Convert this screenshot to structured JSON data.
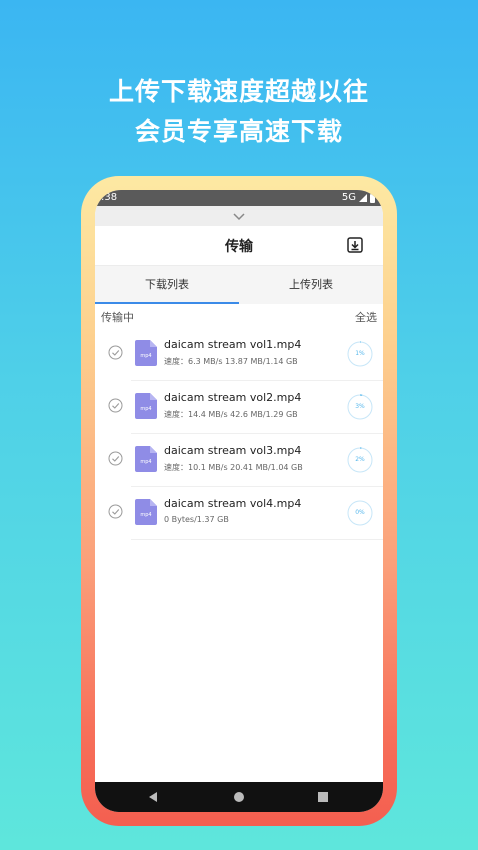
{
  "promo": {
    "line1": "上传下载速度超越以往",
    "line2": "会员专享高速下载"
  },
  "statusbar": {
    "time": ":38",
    "network": "5G"
  },
  "appbar": {
    "title": "传输"
  },
  "tabs": [
    {
      "label": "下载列表",
      "active": true
    },
    {
      "label": "上传列表",
      "active": false
    }
  ],
  "section": {
    "label": "传输中",
    "select_all": "全选"
  },
  "file_icon_text": "mp4",
  "downloads": [
    {
      "name": "daicam stream vol1.mp4",
      "meta": "速度：6.3 MB/s 13.87 MB/1.14 GB",
      "progress": "1%",
      "progress_value": 0.01
    },
    {
      "name": "daicam stream vol2.mp4",
      "meta": "速度：14.4 MB/s 42.6 MB/1.29 GB",
      "progress": "3%",
      "progress_value": 0.03
    },
    {
      "name": "daicam stream vol3.mp4",
      "meta": "速度：10.1 MB/s 20.41 MB/1.04 GB",
      "progress": "2%",
      "progress_value": 0.02
    },
    {
      "name": "daicam stream vol4.mp4",
      "meta": "0 Bytes/1.37 GB",
      "progress": "0%",
      "progress_value": 0.0
    }
  ],
  "colors": {
    "accent": "#3b8be8",
    "progress_ring": "#56b7ec",
    "file_icon": "#8f8ce6"
  }
}
